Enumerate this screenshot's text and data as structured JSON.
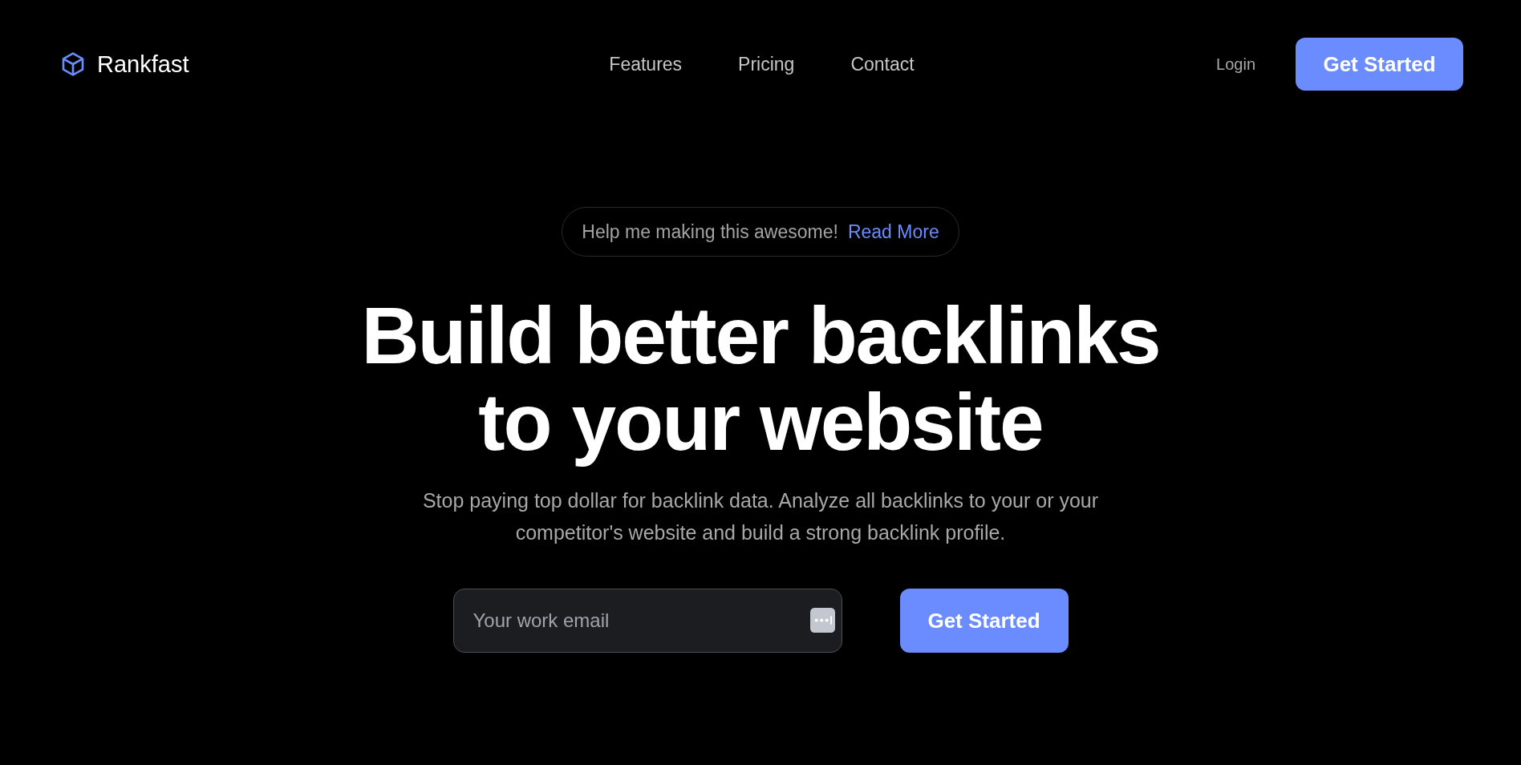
{
  "brand": {
    "name": "Rankfast"
  },
  "nav": [
    {
      "label": "Features"
    },
    {
      "label": "Pricing"
    },
    {
      "label": "Contact"
    }
  ],
  "header_actions": {
    "login": "Login",
    "cta": "Get Started"
  },
  "announcement": {
    "text": "Help me making this awesome!",
    "link": "Read More"
  },
  "hero": {
    "title_lines": [
      "Build better backlinks",
      "to your website"
    ],
    "subtitle": "Stop paying top dollar for backlink data. Analyze all backlinks to your or your competitor's website and build a strong backlink profile."
  },
  "signup": {
    "placeholder": "Your work email",
    "button": "Get Started"
  }
}
